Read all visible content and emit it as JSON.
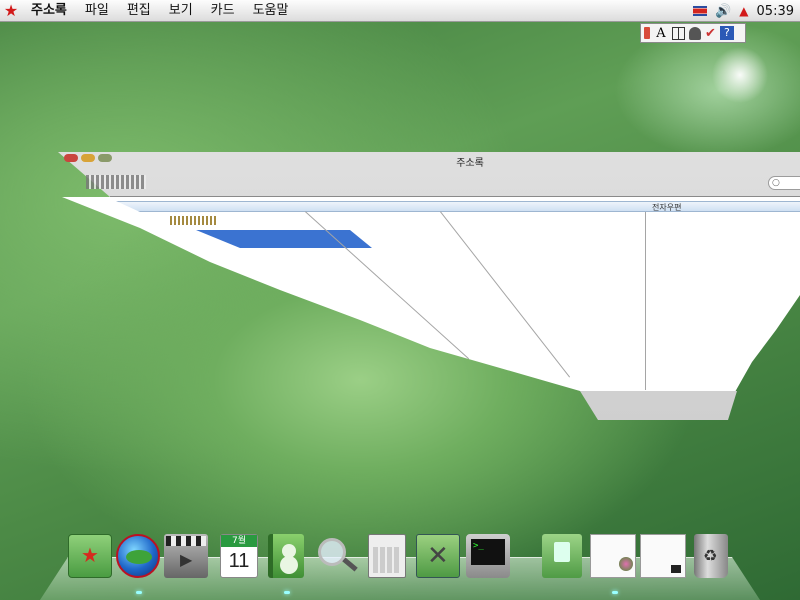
{
  "menubar": {
    "app_name": "주소록",
    "items": [
      "파일",
      "편집",
      "보기",
      "카드",
      "도움말"
    ],
    "clock": "05:39"
  },
  "ime_bar": {
    "letter": "A",
    "help": "?"
  },
  "window": {
    "title": "주소록",
    "columns": [
      "",
      "",
      "",
      "전자우편"
    ]
  },
  "dock": {
    "calendar_month": "7월",
    "calendar_day": "11",
    "terminal_prompt": ">_"
  },
  "colors": {
    "selection": "#3b73d1",
    "menubar": "#eeeeee",
    "desktop_green": "#5f9e55"
  }
}
